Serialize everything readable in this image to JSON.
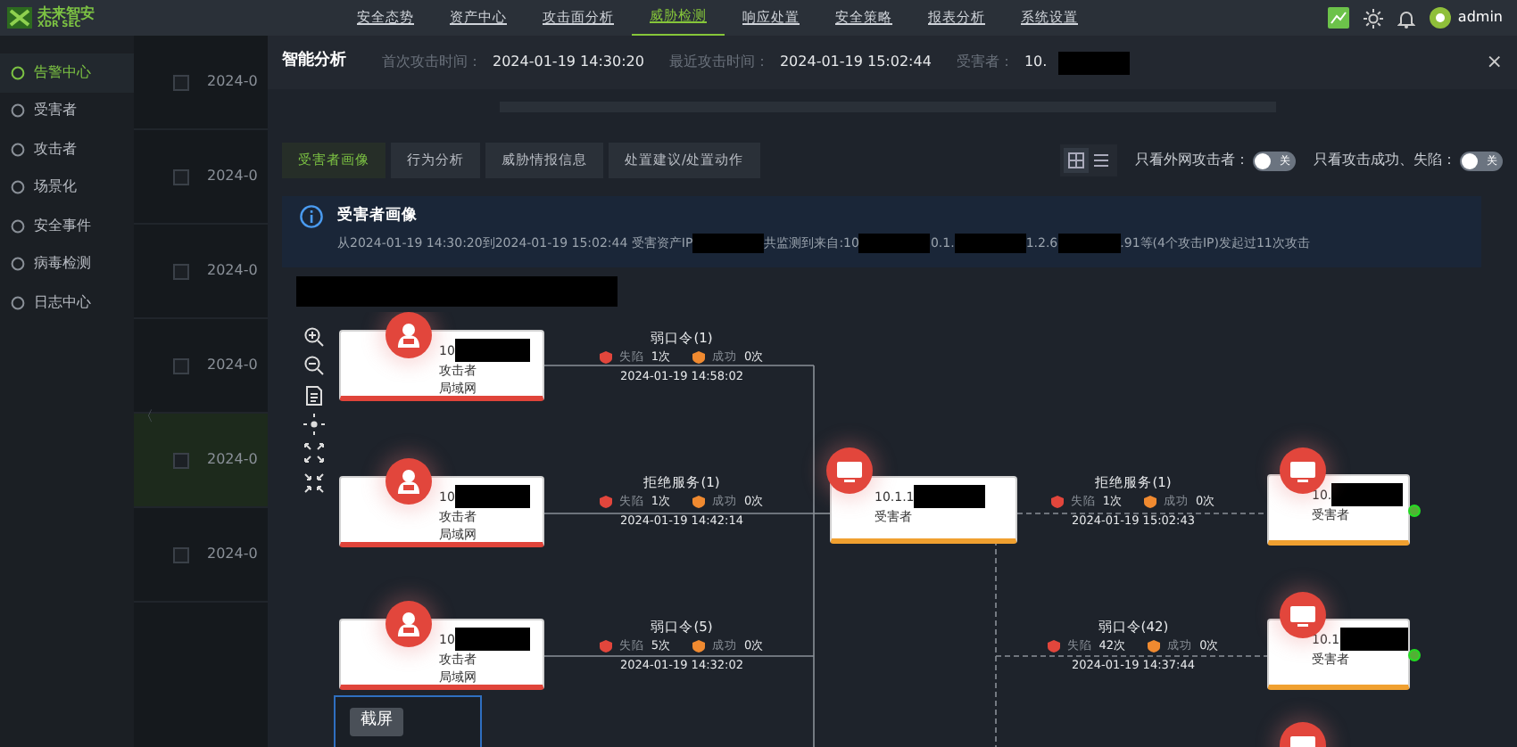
{
  "top_nav": {
    "logo_text": "未来智安",
    "logo_sub": "XDR SEC",
    "items": [
      {
        "label": "安全态势",
        "selected": false
      },
      {
        "label": "资产中心",
        "selected": false
      },
      {
        "label": "攻击面分析",
        "selected": false
      },
      {
        "label": "威胁检测",
        "selected": true
      },
      {
        "label": "响应处置",
        "selected": false
      },
      {
        "label": "安全策略",
        "selected": false
      },
      {
        "label": "报表分析",
        "selected": false
      },
      {
        "label": "系统设置",
        "selected": false
      }
    ],
    "user": "admin"
  },
  "sidebar": {
    "items": [
      {
        "label": "告警中心",
        "selected": true
      },
      {
        "label": "受害者",
        "selected": false
      },
      {
        "label": "攻击者",
        "selected": false
      },
      {
        "label": "场景化",
        "selected": false
      },
      {
        "label": "安全事件",
        "selected": false
      },
      {
        "label": "病毒检测",
        "selected": false
      },
      {
        "label": "日志中心",
        "selected": false
      }
    ]
  },
  "background_list": {
    "collapse_glyph": "〈",
    "rows": [
      {
        "date": "2024-0",
        "highlighted": false,
        "checked": false
      },
      {
        "date": "2024-0",
        "highlighted": false,
        "checked": false
      },
      {
        "date": "2024-0",
        "highlighted": false,
        "checked": false
      },
      {
        "date": "2024-0",
        "highlighted": false,
        "checked": false
      },
      {
        "date": "2024-0",
        "highlighted": true,
        "checked": false
      },
      {
        "date": "2024-0",
        "highlighted": false,
        "checked": false
      }
    ]
  },
  "drawer": {
    "title": "智能分析",
    "fields": [
      {
        "label": "首次攻击时间：",
        "value": "2024-01-19 14:30:20"
      },
      {
        "label": "最近攻击时间：",
        "value": "2024-01-19 15:02:44"
      },
      {
        "label": "受害者：",
        "value": "10.",
        "redacted": true
      }
    ],
    "close": "×"
  },
  "tabs": [
    {
      "label": "受害者画像",
      "selected": true
    },
    {
      "label": "行为分析",
      "selected": false
    },
    {
      "label": "威胁情报信息",
      "selected": false
    },
    {
      "label": "处置建议/处置动作",
      "selected": false
    }
  ],
  "view_modes": [
    {
      "kind": "grid",
      "selected": true
    },
    {
      "kind": "list",
      "selected": false
    }
  ],
  "filters": [
    {
      "label": "只看外网攻击者：",
      "on": false,
      "switch_text": "关"
    },
    {
      "label": "只看攻击成功、失陷：",
      "on": false,
      "switch_text": "关"
    }
  ],
  "info": {
    "title": "受害者画像",
    "segments": [
      {
        "kind": "text",
        "text": "从2024-01-19 14:30:20到2024-01-19 15:02:44 受害资产IP"
      },
      {
        "kind": "redacted"
      },
      {
        "kind": "text",
        "text": "共监测到来自:10"
      },
      {
        "kind": "redacted"
      },
      {
        "kind": "text",
        "text": "0.1."
      },
      {
        "kind": "redacted"
      },
      {
        "kind": "text",
        "text": "1.2.6"
      },
      {
        "kind": "redacted"
      },
      {
        "kind": "text",
        "text": ".91等(4个攻击IP)发起过11次攻击"
      }
    ]
  },
  "redacted_line": true,
  "graph": {
    "attackers": [
      {
        "ip": "10",
        "redacted": true,
        "role": "攻击者",
        "zone": "局域网"
      },
      {
        "ip": "10",
        "redacted": true,
        "role": "攻击者",
        "zone": "局域网"
      },
      {
        "ip": "10",
        "redacted": true,
        "role": "攻击者",
        "zone": "局域网"
      }
    ],
    "attack_edges": [
      {
        "attack": "弱口令(1)",
        "fail_label": "失陷",
        "fail": "1次",
        "success_label": "成功",
        "success": "0次",
        "time": "2024-01-19 14:58:02"
      },
      {
        "attack": "拒绝服务(1)",
        "fail_label": "失陷",
        "fail": "1次",
        "success_label": "成功",
        "success": "0次",
        "time": "2024-01-19 14:42:14"
      },
      {
        "attack": "弱口令(5)",
        "fail_label": "失陷",
        "fail": "5次",
        "success_label": "成功",
        "success": "0次",
        "time": "2024-01-19 14:32:02"
      }
    ],
    "victim": {
      "ip": "10.1.1",
      "redacted": true,
      "role": "受害者"
    },
    "spread_edges": [
      {
        "attack": "拒绝服务(1)",
        "fail_label": "失陷",
        "fail": "1次",
        "success_label": "成功",
        "success": "0次",
        "time": "2024-01-19 15:02:43"
      },
      {
        "attack": "弱口令(42)",
        "fail_label": "失陷",
        "fail": "42次",
        "success_label": "成功",
        "success": "0次",
        "time": "2024-01-19 14:37:44"
      }
    ],
    "targets": [
      {
        "ip": "10.",
        "redacted": true,
        "role": "受害者",
        "expandable": true
      },
      {
        "ip": "10.1",
        "redacted": true,
        "role": "受害者",
        "expandable": true
      }
    ],
    "minimap_label": "截屏"
  }
}
